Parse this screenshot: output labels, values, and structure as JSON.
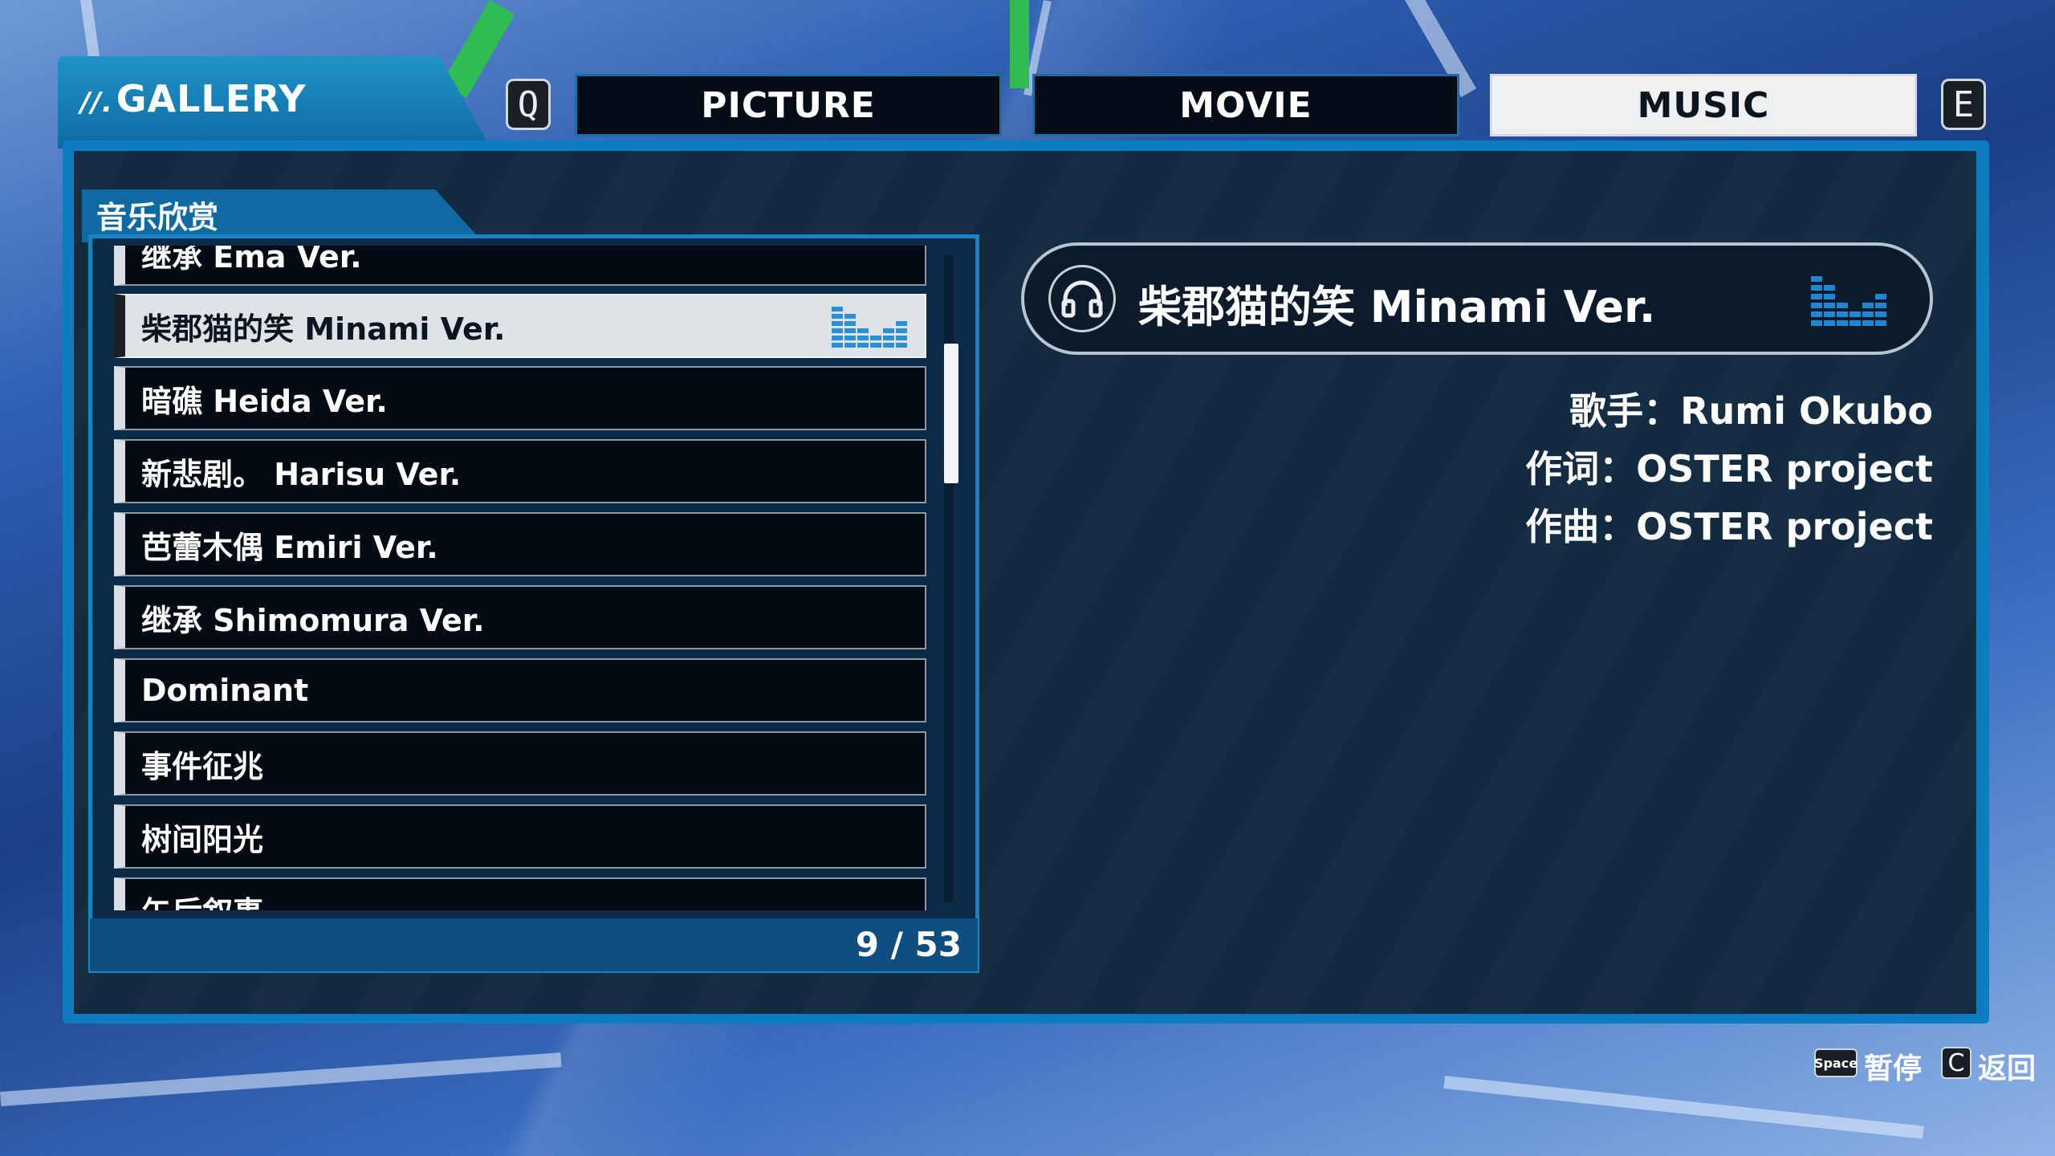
{
  "header": {
    "gallery_prefix": "//.",
    "gallery_title": "GALLERY",
    "key_left": "Q",
    "key_right": "E",
    "tabs": [
      {
        "label": "PICTURE",
        "active": false
      },
      {
        "label": "MOVIE",
        "active": false
      },
      {
        "label": "MUSIC",
        "active": true
      }
    ]
  },
  "list": {
    "section_title": "音乐欣赏",
    "tracks": [
      {
        "title": "继承 Ema Ver.",
        "selected": false
      },
      {
        "title": "柴郡猫的笑 Minami Ver.",
        "selected": true
      },
      {
        "title": "暗礁 Heida Ver.",
        "selected": false
      },
      {
        "title": "新悲剧。 Harisu Ver.",
        "selected": false
      },
      {
        "title": "芭蕾木偶 Emiri Ver.",
        "selected": false
      },
      {
        "title": "继承 Shimomura Ver.",
        "selected": false
      },
      {
        "title": "Dominant",
        "selected": false
      },
      {
        "title": "事件征兆",
        "selected": false
      },
      {
        "title": "树间阳光",
        "selected": false
      },
      {
        "title": "午后叙事",
        "selected": false
      }
    ],
    "counter": "9 / 53",
    "scroll_fraction": 0.17
  },
  "now_playing": {
    "title": "柴郡猫的笑 Minami Ver.",
    "icon": "headphones-icon",
    "singer": "歌手：Rumi Okubo",
    "lyricist": "作词：OSTER project",
    "composer": "作曲：OSTER project"
  },
  "hints": {
    "space_key": "Space",
    "space_label": "暂停",
    "c_key": "C",
    "c_label": "返回"
  },
  "colors": {
    "accent_blue": "#0f6aa3",
    "panel_border": "#1583c6",
    "selected_bg": "#dfe3e6",
    "eq_blue": "#2a8fd6"
  }
}
